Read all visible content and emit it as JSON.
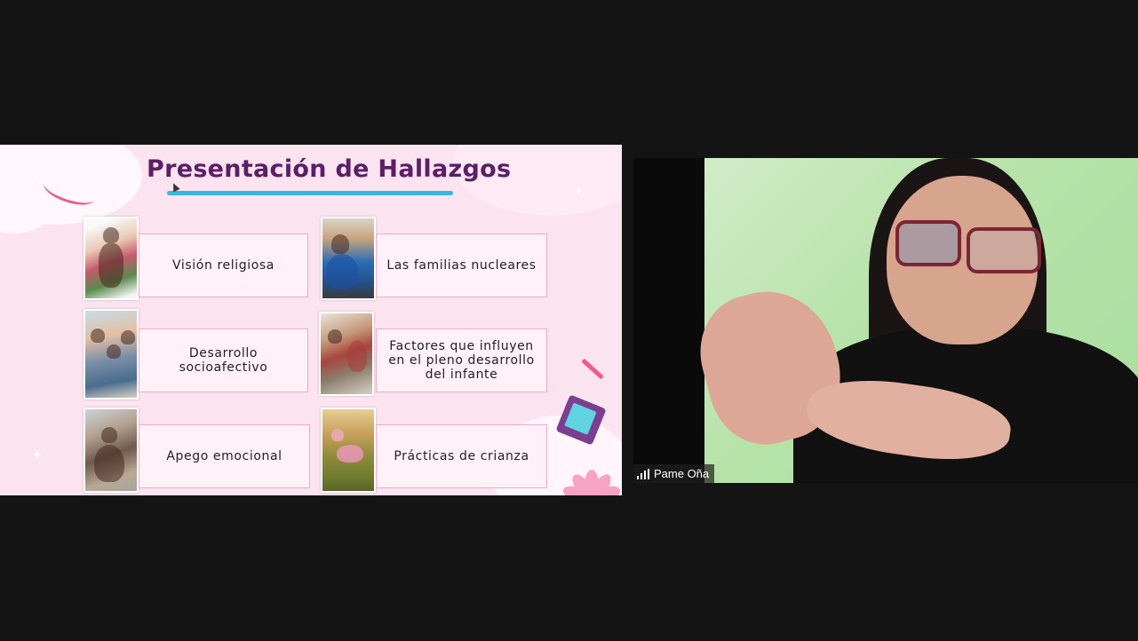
{
  "slide": {
    "title": "Presentación de Hallazgos",
    "cards": [
      {
        "label": "Visión religiosa"
      },
      {
        "label": "Las familias nucleares"
      },
      {
        "label": "Desarrollo socioafectivo"
      },
      {
        "label": "Factores que influyen en el pleno desarrollo del infante"
      },
      {
        "label": "Apego emocional"
      },
      {
        "label": "Prácticas de crianza"
      }
    ]
  },
  "participant": {
    "name": "Pame Oña",
    "signal_icon": "signal-bars-icon"
  },
  "colors": {
    "slide_background": "#fbe3ef",
    "title": "#5a1f66",
    "title_underline": "#35b9d8",
    "card_border": "#f0a9c6",
    "window_background": "#141414"
  }
}
